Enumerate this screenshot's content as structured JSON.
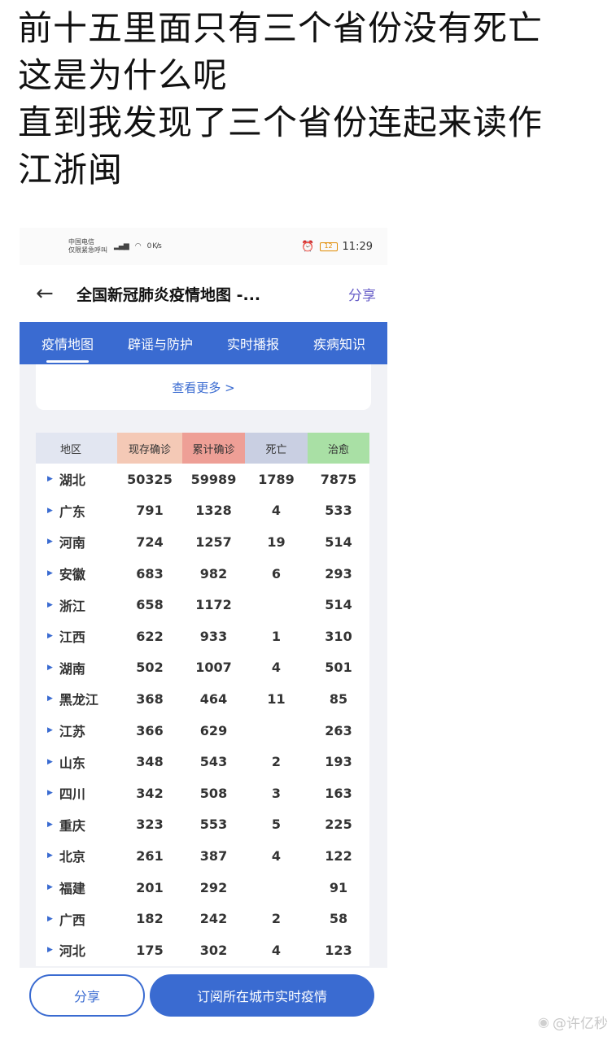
{
  "caption": [
    "前十五里面只有三个省份没有死亡",
    "这是为什么呢",
    "直到我发现了三个省份连起来读作",
    "江浙闽"
  ],
  "status_bar": {
    "carrier_line1": "中国电信",
    "carrier_line2": "仅限紧急呼叫",
    "net_speed": "0 K/s",
    "battery": "12",
    "time": "11:29"
  },
  "appbar": {
    "title": "全国新冠肺炎疫情地图 -...",
    "share": "分享"
  },
  "tabs": [
    "疫情地图",
    "辟谣与防护",
    "实时播报",
    "疾病知识"
  ],
  "more_link": "查看更多 >",
  "table": {
    "headers": [
      "地区",
      "现存确诊",
      "累计确诊",
      "死亡",
      "治愈"
    ],
    "rows": [
      [
        "湖北",
        "50325",
        "59989",
        "1789",
        "7875"
      ],
      [
        "广东",
        "791",
        "1328",
        "4",
        "533"
      ],
      [
        "河南",
        "724",
        "1257",
        "19",
        "514"
      ],
      [
        "安徽",
        "683",
        "982",
        "6",
        "293"
      ],
      [
        "浙江",
        "658",
        "1172",
        "",
        "514"
      ],
      [
        "江西",
        "622",
        "933",
        "1",
        "310"
      ],
      [
        "湖南",
        "502",
        "1007",
        "4",
        "501"
      ],
      [
        "黑龙江",
        "368",
        "464",
        "11",
        "85"
      ],
      [
        "江苏",
        "366",
        "629",
        "",
        "263"
      ],
      [
        "山东",
        "348",
        "543",
        "2",
        "193"
      ],
      [
        "四川",
        "342",
        "508",
        "3",
        "163"
      ],
      [
        "重庆",
        "323",
        "553",
        "5",
        "225"
      ],
      [
        "北京",
        "261",
        "387",
        "4",
        "122"
      ],
      [
        "福建",
        "201",
        "292",
        "",
        "91"
      ],
      [
        "广西",
        "182",
        "242",
        "2",
        "58"
      ],
      [
        "河北",
        "175",
        "302",
        "4",
        "123"
      ]
    ]
  },
  "bottom": {
    "share_button": "分享",
    "subscribe_button": "订阅所在城市实时疫情"
  },
  "watermark": "@许亿秒",
  "colors": {
    "primary": "#3a6bd1",
    "header_current": "#f4c9b6",
    "header_total": "#ee9f96",
    "header_death": "#c9cfe2",
    "header_cured": "#a9e0a5"
  }
}
